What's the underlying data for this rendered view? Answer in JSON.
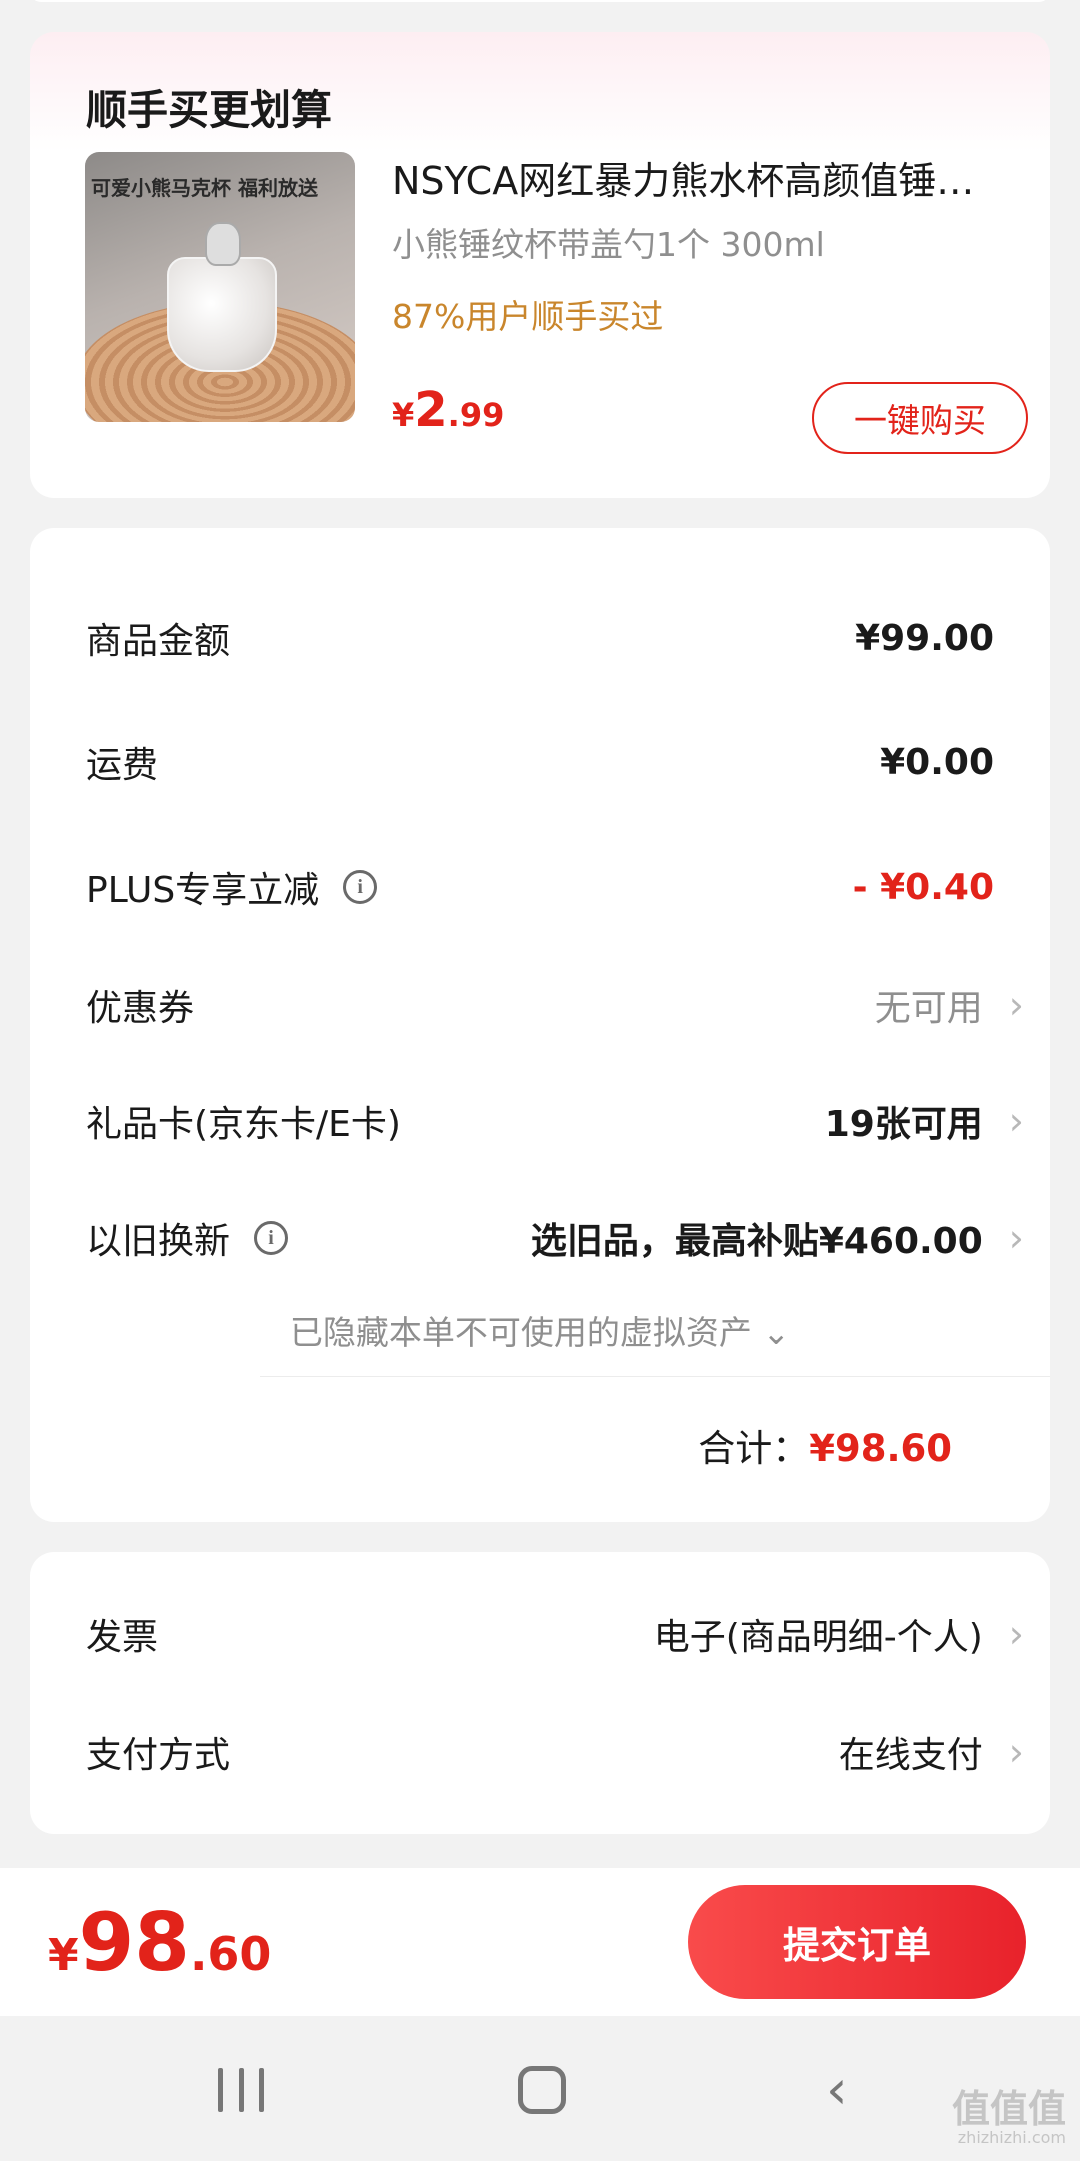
{
  "upsell": {
    "title": "顺手买更划算",
    "product_name": "NSYCA网红暴力熊水杯高颜值锤…",
    "product_spec": "小熊锤纹杯带盖勺1个 300ml",
    "product_stat": "87%用户顺手买过",
    "price_currency": "¥",
    "price_int": "2",
    "price_dec": ".99",
    "buy_label": "一键购买",
    "thumb_caption": "可爱小熊马克杯 福利放送"
  },
  "summary": {
    "rows": [
      {
        "label": "商品金额",
        "value": "¥99.00"
      },
      {
        "label": "运费",
        "value": "¥0.00"
      },
      {
        "label": "PLUS专享立减",
        "value": "- ¥0.40"
      },
      {
        "label": "优惠券",
        "value": "无可用"
      },
      {
        "label": "礼品卡(京东卡/E卡)",
        "value": "19张可用"
      },
      {
        "label": "以旧换新",
        "value": "选旧品，最高补贴¥460.00"
      }
    ],
    "hidden_note": "已隐藏本单不可使用的虚拟资产 ⌄",
    "total_label": "合计：",
    "total_value": "¥98.60"
  },
  "settings": {
    "rows": [
      {
        "label": "发票",
        "value": "电子(商品明细-个人)"
      },
      {
        "label": "支付方式",
        "value": "在线支付"
      }
    ]
  },
  "footer": {
    "price_currency": "¥",
    "price_int": "98",
    "price_dec": ".60",
    "submit_label": "提交订单"
  },
  "watermark": {
    "text": "值值值",
    "sub": "zhizhizhi.com"
  },
  "icons": {
    "info": "info-icon",
    "chevron": "chevron-right-icon",
    "nav_recent": "recent-apps-icon",
    "nav_home": "home-icon",
    "nav_back": "back-icon"
  },
  "colors": {
    "accent_red": "#e2231a",
    "stat_orange": "#c9862c",
    "muted_gray": "#8f8f8f"
  }
}
